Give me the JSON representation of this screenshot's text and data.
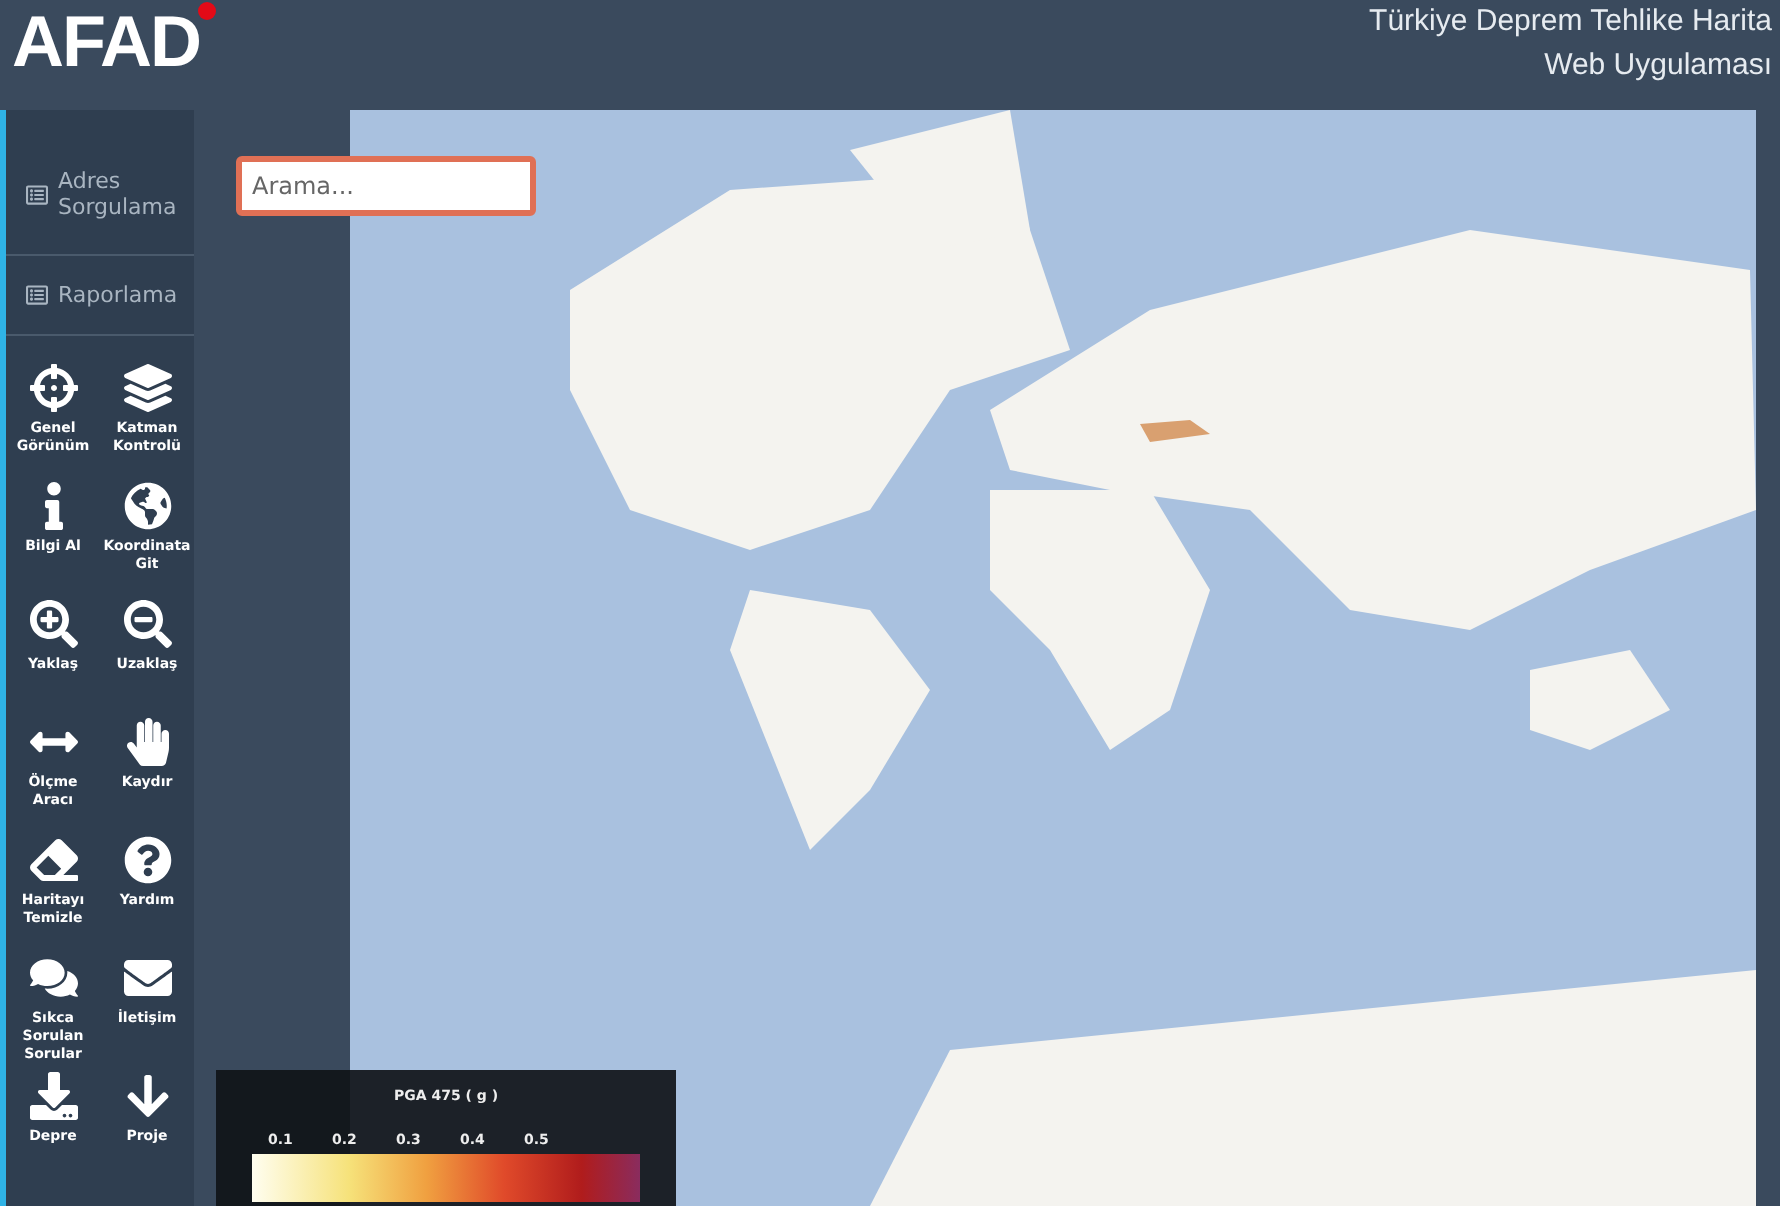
{
  "header": {
    "logo": "AFAD",
    "title_lines": [
      "Türkiye Deprem Tehlike Harita",
      "Web Uygulaması"
    ]
  },
  "sidebar": {
    "menu": [
      {
        "label": "Adres Sorgulama"
      },
      {
        "label": "Raporlama"
      }
    ],
    "tools": [
      {
        "label": "Genel Görünüm"
      },
      {
        "label": "Katman Kontrolü"
      },
      {
        "label": "Bilgi Al"
      },
      {
        "label": "Koordinata Git"
      },
      {
        "label": "Yaklaş"
      },
      {
        "label": "Uzaklaş"
      },
      {
        "label": "Ölçme Aracı"
      },
      {
        "label": "Kaydır"
      },
      {
        "label": "Haritayı Temizle"
      },
      {
        "label": "Yardım"
      },
      {
        "label": "Sıkca Sorulan Sorular"
      },
      {
        "label": "İletişim"
      },
      {
        "label": "Depre"
      },
      {
        "label": "Proje"
      }
    ]
  },
  "search": {
    "placeholder": "Arama..."
  },
  "legend": {
    "title": "PGA 475 ( g )",
    "ticks": [
      "0.1",
      "0.2",
      "0.3",
      "0.4",
      "0.5"
    ]
  }
}
